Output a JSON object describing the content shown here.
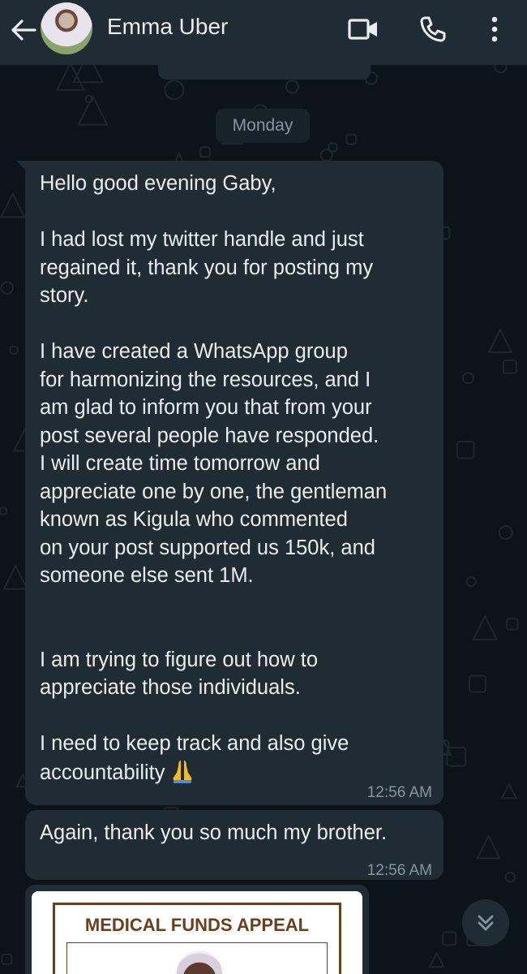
{
  "header": {
    "contact_name": "Emma Uber",
    "icons": [
      "back-arrow-icon",
      "video-call-icon",
      "voice-call-icon",
      "more-options-icon"
    ]
  },
  "chat": {
    "date_label": "Monday",
    "messages": [
      {
        "lines": [
          "Hello good evening Gaby,",
          "",
          "I had lost my twitter handle and just",
          "regained it, thank you for posting my",
          "story.",
          "",
          "I have created a WhatsApp group",
          "for harmonizing the resources, and I",
          "am glad to inform you that from your",
          "post several people have responded.",
          "I will create time tomorrow and",
          "appreciate one by one, the gentleman",
          "known as Kigula who commented",
          "on your post supported us 150k, and",
          "someone else sent 1M.",
          "",
          "",
          "I am trying to figure out how to",
          "appreciate those individuals.",
          "",
          "I need to keep track and also give",
          "accountability"
        ],
        "emoji": "folded-hands",
        "time": "12:56 AM"
      },
      {
        "lines": [
          "Again, thank you so much my brother."
        ],
        "time": "12:56 AM"
      }
    ],
    "image_message": {
      "title": "MEDICAL FUNDS APPEAL"
    }
  },
  "colors": {
    "header_bg": "#1f2c34",
    "bubble_bg": "#1f2c34",
    "chat_bg": "#0b141a",
    "text": "#e9edef",
    "meta": "#8696a0",
    "poster_accent": "#6b3e1c"
  }
}
